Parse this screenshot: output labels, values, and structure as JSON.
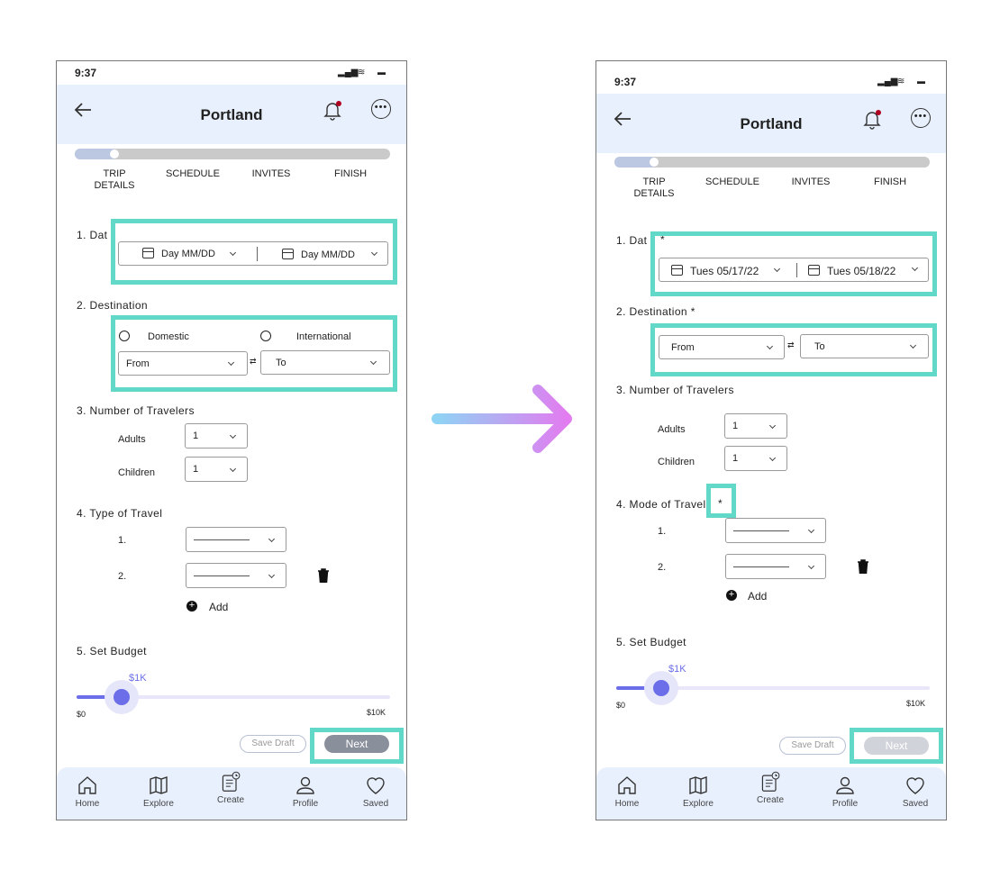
{
  "status_time": "9:37",
  "header_title": "Portland",
  "steps": [
    "TRIP\nDETAILS",
    "SCHEDULE",
    "INVITES",
    "FINISH"
  ],
  "before": {
    "sec1": "1. Dat",
    "date_from": "Day MM/DD",
    "date_to": "Day MM/DD",
    "sec2": "2. Destination",
    "radio_domestic": "Domestic",
    "radio_international": "International",
    "from": "From",
    "to": "To",
    "sec3": "3. Number of Travelers",
    "adults_label": "Adults",
    "adults_value": "1",
    "children_label": "Children",
    "children_value": "1",
    "sec4": "4. Type of Travel",
    "row1": "1.",
    "row2": "2.",
    "add": "Add",
    "sec5": "5. Set Budget",
    "budget_value": "$1K",
    "budget_min": "$0",
    "budget_max": "$10K",
    "budget_fraction": 0.1,
    "save_draft": "Save Draft",
    "next": "Next"
  },
  "after": {
    "sec1": "1. Dat",
    "sec1_star": "*",
    "date_from": "Tues 05/17/22",
    "date_to": "Tues 05/18/22",
    "sec2": "2. Destination *",
    "from": "From",
    "to": "To",
    "sec3": "3. Number of Travelers",
    "adults_label": "Adults",
    "adults_value": "1",
    "children_label": "Children",
    "children_value": "1",
    "sec4": "4. Mode of Travel",
    "sec4_star": "*",
    "row1": "1.",
    "row2": "2.",
    "add": "Add",
    "sec5": "5. Set Budget",
    "budget_value": "$1K",
    "budget_min": "$0",
    "budget_max": "$10K",
    "budget_fraction": 0.1,
    "save_draft": "Save Draft",
    "next": "Next"
  },
  "nav": [
    "Home",
    "Explore",
    "Create",
    "Profile",
    "Saved"
  ],
  "colors": {
    "highlight": "#62d8c8",
    "header_bg": "#e8f0fd",
    "slider": "#6b6ee8",
    "arrow_start": "#8fd3f4",
    "arrow_end": "#e27cf0",
    "next_enabled": "#8a8f9c",
    "next_disabled": "#d0d3da"
  }
}
